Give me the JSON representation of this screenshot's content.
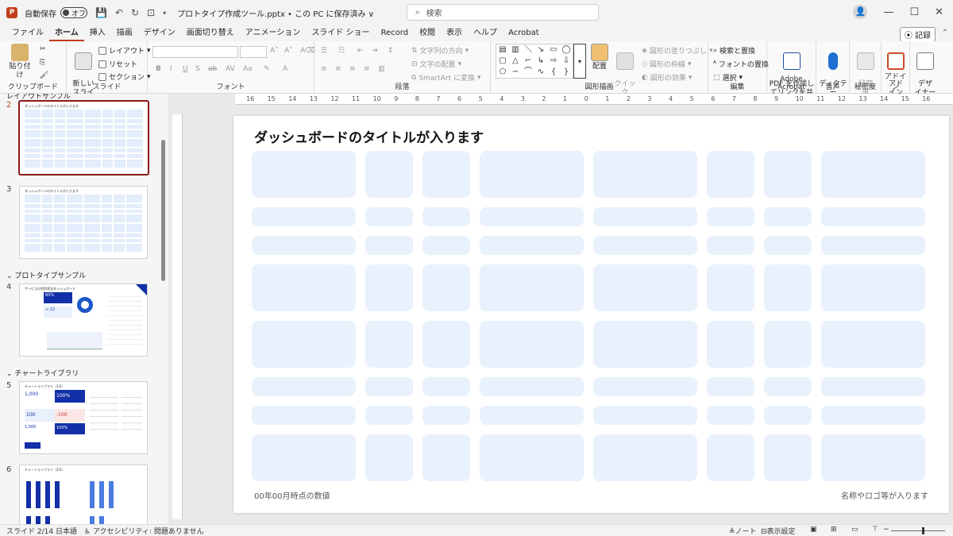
{
  "titlebar": {
    "autosave_label": "自動保存",
    "autosave_state": "オフ",
    "filename": "プロトタイプ作成ツール.pptx • この PC に保存済み ∨",
    "search_placeholder": "検索"
  },
  "tabs": [
    "ファイル",
    "ホーム",
    "挿入",
    "描画",
    "デザイン",
    "画面切り替え",
    "アニメーション",
    "スライド ショー",
    "Record",
    "校閲",
    "表示",
    "ヘルプ",
    "Acrobat"
  ],
  "record_button": "記録",
  "ribbon": {
    "clipboard": {
      "paste": "貼り付け",
      "label": "クリップボード"
    },
    "slides": {
      "new_slide": "新しい\nスライド",
      "layout": "レイアウト",
      "reset": "リセット",
      "section": "セクション",
      "label": "スライド"
    },
    "font": {
      "label": "フォント"
    },
    "paragraph": {
      "text_direction": "文字列の方向",
      "align_text": "文字の配置",
      "smartart": "SmartArt に変換",
      "label": "段落"
    },
    "drawing": {
      "arrange": "配置",
      "quick_styles": "クイック\nスタイル",
      "shape_fill": "図形の塗りつぶし",
      "shape_outline": "図形の枠線",
      "shape_effects": "図形の効果",
      "label": "図形描画"
    },
    "editing": {
      "find_replace": "検索と置換",
      "replace_fonts": "フォントの置換",
      "select": "選択",
      "label": "編集"
    },
    "acrobat": {
      "create_pdf": "PDF を作成し\nてリンクを共有",
      "label": "Adobe Acrobat"
    },
    "voice": {
      "dictate": "ディクテー\nション",
      "label": "音声"
    },
    "sensitivity": {
      "btn": "秘密\n度",
      "label": "秘密度"
    },
    "addins": {
      "btn": "アド\nイン",
      "label": "アドイン"
    },
    "designer": {
      "btn": "デザ\nイナー"
    }
  },
  "slide_panel": {
    "sections": [
      "レイアウトサンプル",
      "プロトタイプサンプル",
      "チャートライブラリ"
    ],
    "slides": [
      {
        "num": "2",
        "title": "ダッシュボードのタイトルが入ります",
        "selected": true
      },
      {
        "num": "3",
        "title": "ダッシュボードのタイトルが入ります"
      },
      {
        "num": "4",
        "title": "サービスの利用状況ダッシュボード"
      },
      {
        "num": "5",
        "title": "チャートライブラリ（1/3）"
      },
      {
        "num": "6",
        "title": "チャートライブラリ（2/3）"
      }
    ],
    "slide4_kpi": "60%",
    "slide4_kpi2": "12",
    "slide5_kpis": [
      "1,000",
      "100%",
      "100",
      "-100",
      "1,000",
      "100%"
    ]
  },
  "slide": {
    "title": "ダッシュボードのタイトルが入ります",
    "footer_left": "00年00月時点の数値",
    "footer_right": "名称やロゴ等が入ります",
    "grid_rows": 8,
    "grid_cols": 8
  },
  "ruler_ticks": [
    "16",
    "15",
    "14",
    "13",
    "12",
    "11",
    "10",
    "9",
    "8",
    "7",
    "6",
    "5",
    "4",
    "3",
    "2",
    "1",
    "0",
    "1",
    "2",
    "3",
    "4",
    "5",
    "6",
    "7",
    "8",
    "9",
    "10",
    "11",
    "12",
    "13",
    "14",
    "15",
    "16"
  ],
  "statusbar": {
    "slide_info": "スライド 2/14",
    "language": "日本語",
    "accessibility": "アクセシビリティ: 問題ありません",
    "notes": "ノート",
    "display_settings": "表示設定"
  },
  "colors": {
    "accent": "#c43e1c",
    "cell_fill": "#e8f1fc",
    "selection": "#8b1a1a"
  }
}
